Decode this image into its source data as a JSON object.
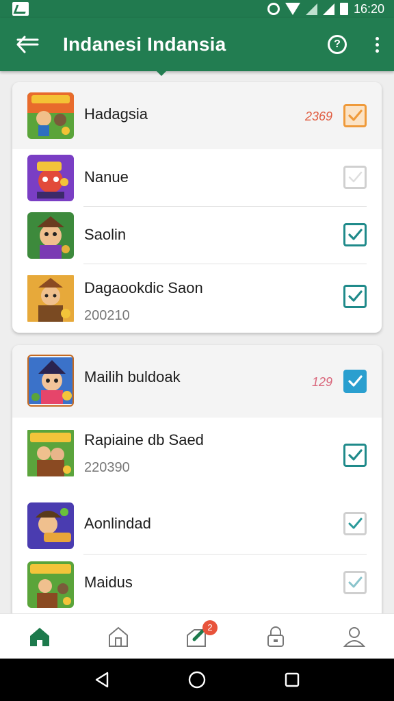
{
  "status_bar": {
    "time": "16:20",
    "icons": [
      "gallery-icon",
      "alarm-icon",
      "wifi-icon",
      "signal-icon",
      "battery-icon"
    ]
  },
  "app_bar": {
    "title": "Indanesi Indansia",
    "back_icon": "back-arrow-icon",
    "actions": [
      "help-icon",
      "more-vert-icon"
    ],
    "color": "#227d51"
  },
  "groups": [
    {
      "items": [
        {
          "name": "Hadagsia",
          "sub": "",
          "count": "2369",
          "count_color": "#e05b3f",
          "checked": true,
          "style": "orange"
        },
        {
          "name": "Nanue",
          "sub": "",
          "count": "",
          "checked": false,
          "style": "grey"
        },
        {
          "name": "Saolin",
          "sub": "",
          "count": "",
          "checked": true,
          "style": "teal"
        },
        {
          "name": "Dagaookdic Saon",
          "sub": "200210",
          "count": "",
          "checked": true,
          "style": "teal"
        }
      ]
    },
    {
      "items": [
        {
          "name": "Mailih buldoak",
          "sub": "",
          "count": "129",
          "count_color": "#d9657a",
          "checked": true,
          "style": "filled"
        },
        {
          "name": "Rapiaine db Saed",
          "sub": "220390",
          "count": "",
          "checked": true,
          "style": "teal"
        },
        {
          "name": "Aonlindad",
          "sub": "",
          "count": "",
          "checked": true,
          "style": "faint"
        },
        {
          "name": "Maidus",
          "sub": "",
          "count": "",
          "checked": true,
          "style": "faint"
        }
      ]
    }
  ],
  "bottom_nav": {
    "items": [
      "home-icon",
      "store-icon",
      "tag-icon",
      "lock-icon",
      "profile-icon"
    ],
    "badge": "2",
    "active_color": "#1d7a4c"
  },
  "system_nav": [
    "back-triangle-icon",
    "home-circle-icon",
    "recents-square-icon"
  ]
}
